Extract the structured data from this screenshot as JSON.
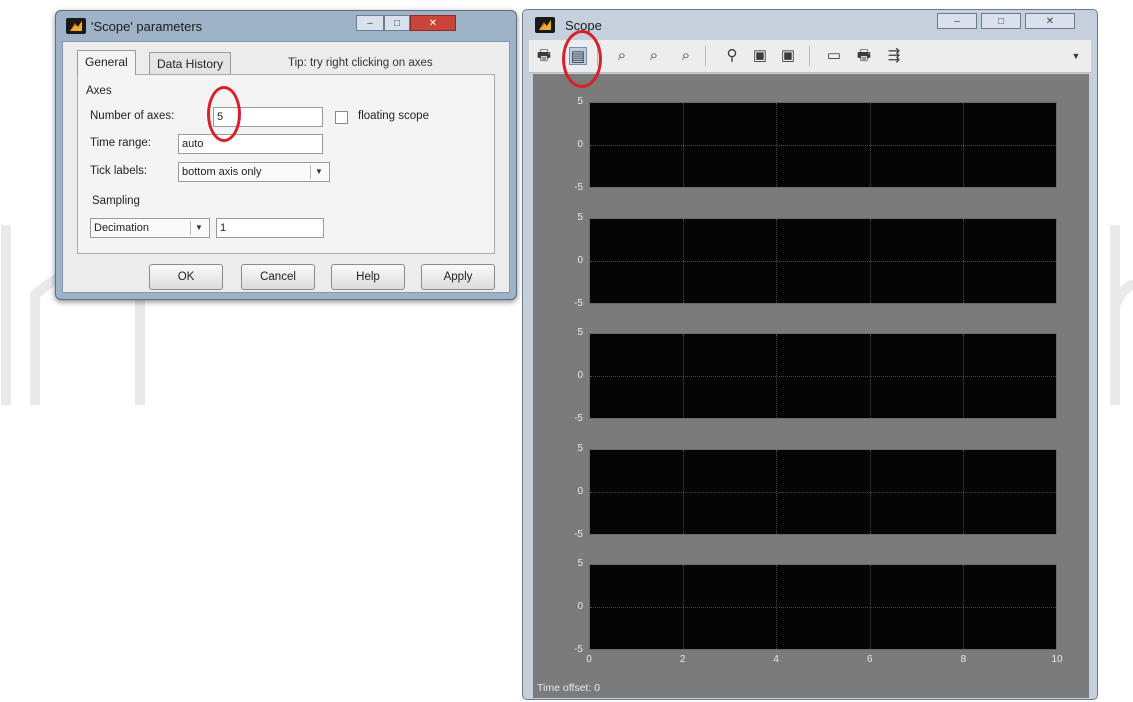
{
  "dialog": {
    "title": "'Scope' parameters",
    "tabs": [
      "General",
      "Data History"
    ],
    "tip": "Tip: try right clicking on axes",
    "axes_group_label": "Axes",
    "number_of_axes_label": "Number of axes:",
    "number_of_axes_value": "5",
    "floating_scope_label": "floating scope",
    "floating_scope_checked": false,
    "time_range_label": "Time range:",
    "time_range_value": "auto",
    "tick_labels_label": "Tick labels:",
    "tick_labels_value": "bottom axis only",
    "sampling_group_label": "Sampling",
    "sampling_mode": "Decimation",
    "sampling_value": "1",
    "buttons": {
      "ok": "OK",
      "cancel": "Cancel",
      "help": "Help",
      "apply": "Apply"
    }
  },
  "scope": {
    "title": "Scope",
    "toolbar_icons": [
      "print-icon",
      "parameters-icon",
      "zoom-icon",
      "zoom-x-icon",
      "zoom-y-icon",
      "autoscale-icon",
      "save-axes-settings-icon",
      "restore-axes-settings-icon",
      "floating-scope-icon",
      "signal-selection-icon",
      "lock-axes-icon"
    ],
    "axes_count": 5,
    "y_ticks": [
      "5",
      "0",
      "-5"
    ],
    "x_ticks": [
      "0",
      "2",
      "4",
      "6",
      "8",
      "10"
    ],
    "time_offset_label": "Time offset:",
    "time_offset_value": "0",
    "background_color": "#7b7b7b",
    "axes_color": "#050505"
  },
  "annotations": {
    "highlight_color": "#d8202a"
  }
}
